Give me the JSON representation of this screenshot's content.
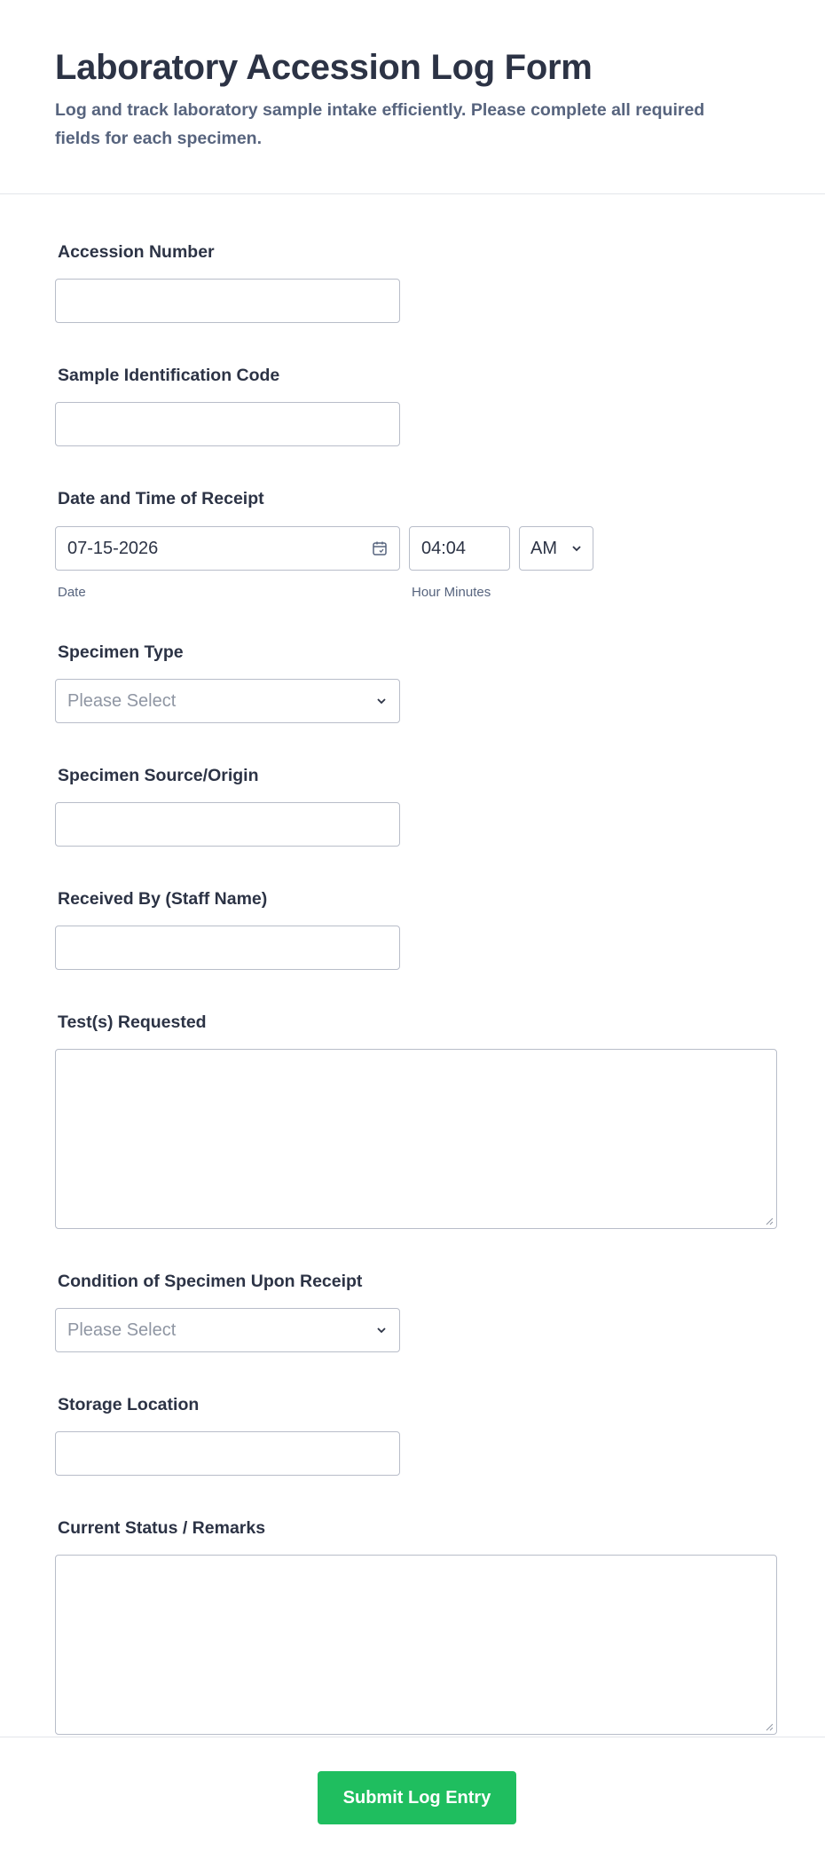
{
  "header": {
    "title": "Laboratory Accession Log Form",
    "subtitle": "Log and track laboratory sample intake efficiently. Please complete all required fields for each specimen."
  },
  "fields": {
    "accession_number": {
      "label": "Accession Number",
      "value": ""
    },
    "sample_id": {
      "label": "Sample Identification Code",
      "value": ""
    },
    "receipt_datetime": {
      "label": "Date and Time of Receipt",
      "date_value": "07-15-2026",
      "time_value": "04:04",
      "ampm_value": "AM",
      "date_sublabel": "Date",
      "time_sublabel": "Hour Minutes"
    },
    "specimen_type": {
      "label": "Specimen Type",
      "placeholder": "Please Select"
    },
    "specimen_source": {
      "label": "Specimen Source/Origin",
      "value": ""
    },
    "received_by": {
      "label": "Received By (Staff Name)",
      "value": ""
    },
    "tests_requested": {
      "label": "Test(s) Requested",
      "value": ""
    },
    "condition": {
      "label": "Condition of Specimen Upon Receipt",
      "placeholder": "Please Select"
    },
    "storage_location": {
      "label": "Storage Location",
      "value": ""
    },
    "status_remarks": {
      "label": "Current Status / Remarks",
      "value": ""
    }
  },
  "footer": {
    "submit_label": "Submit Log Entry"
  },
  "colors": {
    "accent": "#1fbe5f",
    "text": "#2c3345",
    "muted": "#57647e",
    "border": "#b8bdc9"
  },
  "icons": {
    "date": "calendar-icon",
    "dropdown": "chevron-down-icon"
  }
}
